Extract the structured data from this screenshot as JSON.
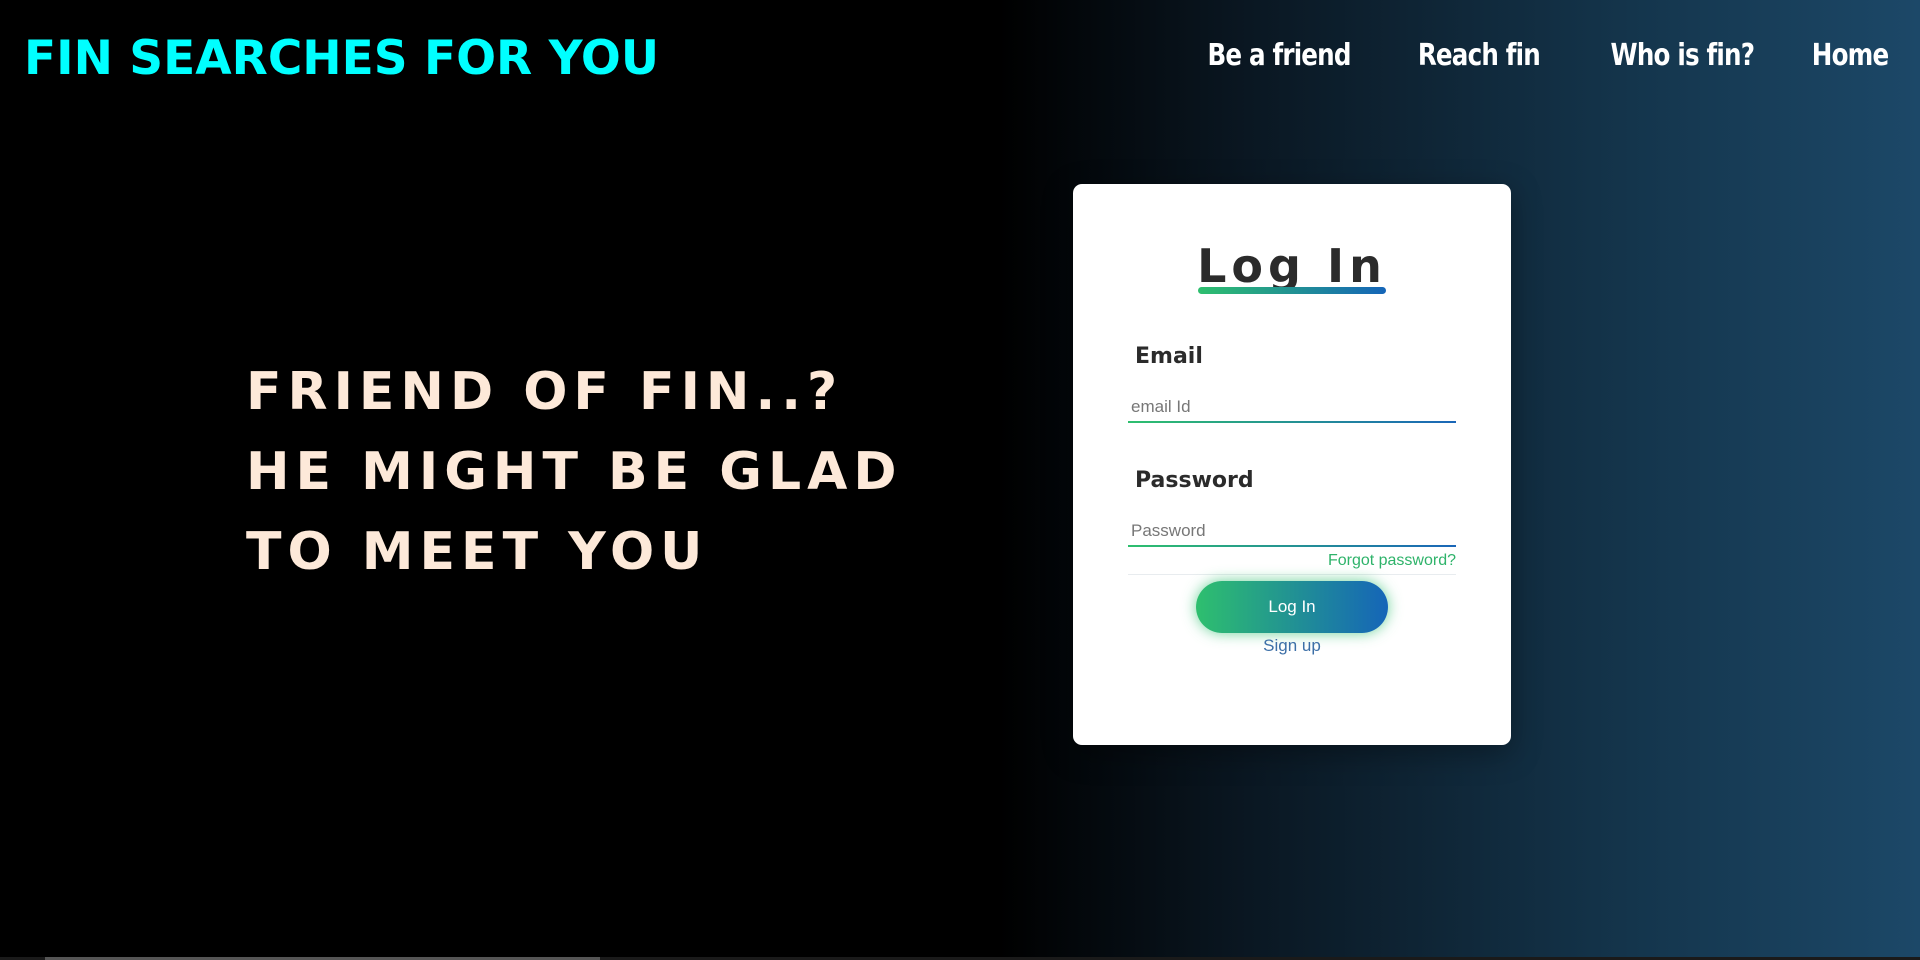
{
  "brand": {
    "title": "FIN SEARCHES FOR YOU"
  },
  "nav": {
    "items": [
      {
        "label": "Be a friend"
      },
      {
        "label": "Reach fin"
      },
      {
        "label": "Who is fin?"
      },
      {
        "label": "Home"
      }
    ]
  },
  "hero": {
    "lines": [
      "FRIEND OF FIN..?",
      "HE MIGHT BE GLAD",
      "TO MEET YOU"
    ]
  },
  "login": {
    "title": "Log In",
    "email_label": "Email",
    "email_placeholder": "email Id",
    "email_value": "",
    "password_label": "Password",
    "password_placeholder": "Password",
    "password_value": "",
    "forgot_label": "Forgot password?",
    "button_label": "Log In",
    "signup_label": "Sign up"
  },
  "colors": {
    "brand": "#00ffff",
    "hero_text": "#fde9d9",
    "accent_green": "#2ebf6e",
    "accent_blue": "#1565b8",
    "card_bg": "#ffffff"
  }
}
